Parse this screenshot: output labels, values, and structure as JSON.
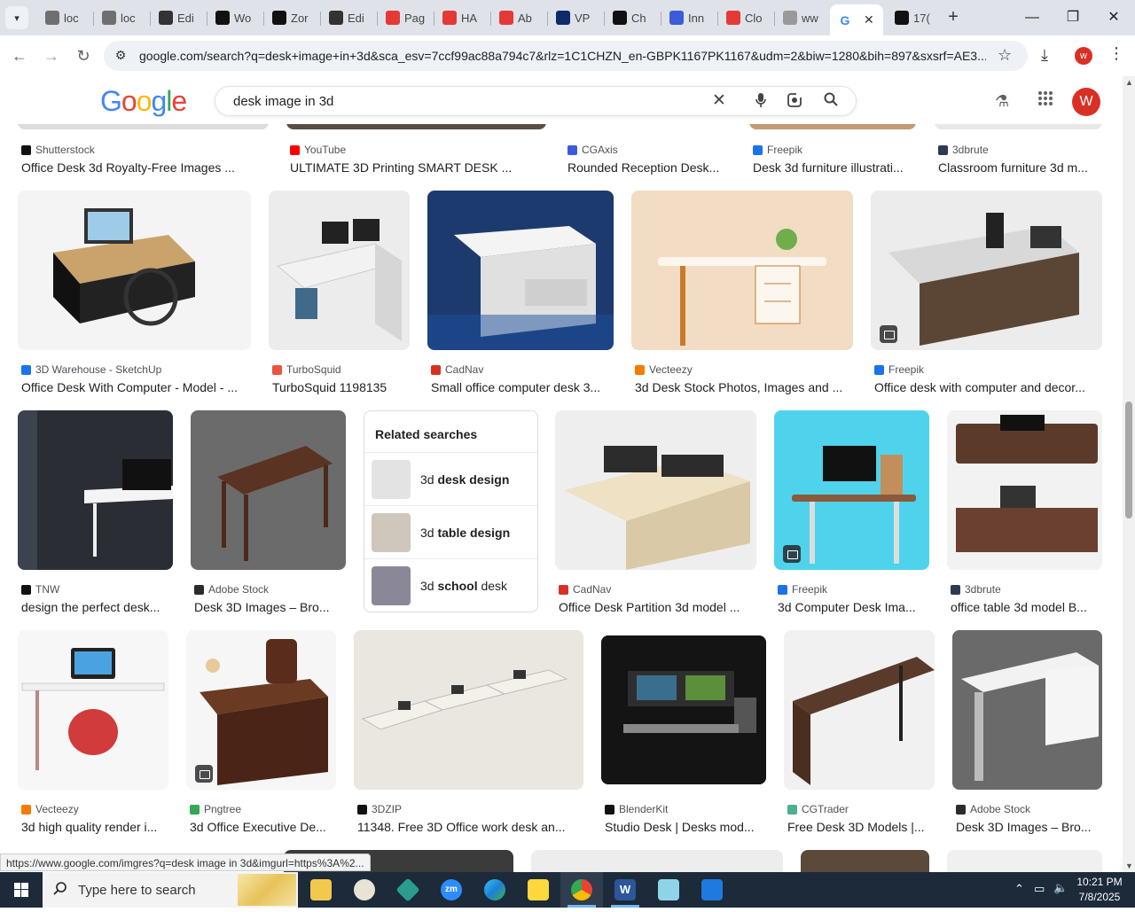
{
  "browser": {
    "tabs": [
      {
        "title": "loc",
        "favicon": "#6f6f6f",
        "icon": "doc-icon"
      },
      {
        "title": "loc",
        "favicon": "#6f6f6f",
        "icon": "doc-icon"
      },
      {
        "title": "Edi",
        "favicon": "#333333",
        "icon": "globe-icon"
      },
      {
        "title": "Wo",
        "favicon": "#111111",
        "icon": "chatgpt-icon"
      },
      {
        "title": "Zor",
        "favicon": "#111111",
        "icon": "z-icon"
      },
      {
        "title": "Edi",
        "favicon": "#333333",
        "icon": "globe-icon"
      },
      {
        "title": "Pag",
        "favicon": "#e53935",
        "icon": "diamond-icon"
      },
      {
        "title": "HA",
        "favicon": "#e53935",
        "icon": "diamond-icon"
      },
      {
        "title": "Ab",
        "favicon": "#e53935",
        "icon": "diamond-icon"
      },
      {
        "title": "VP",
        "favicon": "#0d2a6b",
        "icon": "v-icon"
      },
      {
        "title": "Ch",
        "favicon": "#111111",
        "icon": "chatgpt-icon"
      },
      {
        "title": "Inn",
        "favicon": "#3b5bdb",
        "icon": "inn-icon"
      },
      {
        "title": "Clo",
        "favicon": "#e53935",
        "icon": "slash-icon"
      },
      {
        "title": "ww",
        "favicon": "#999999",
        "icon": "circle-icon"
      },
      {
        "title": "",
        "favicon": "#4285f4",
        "icon": "google-icon",
        "active": true
      },
      {
        "title": "17(",
        "favicon": "#111111",
        "icon": "dollar-icon"
      }
    ],
    "url": "google.com/search?q=desk+image+in+3d&sca_esv=7ccf99ac88a794c7&rlz=1C1CHZN_en-GBPK1167PK1167&udm=2&biw=1280&bih=897&sxsrf=AE3...",
    "profile_initial": "w"
  },
  "google": {
    "logo": [
      "G",
      "o",
      "o",
      "g",
      "l",
      "e"
    ],
    "logo_colors": [
      "#4285f4",
      "#ea4335",
      "#fbbc05",
      "#4285f4",
      "#34a853",
      "#ea4335"
    ],
    "query": "desk image in 3d",
    "avatar_initial": "W"
  },
  "results": [
    {
      "source": "Shutterstock",
      "title": "Office Desk 3d Royalty-Free Images ...",
      "fav": "#111111"
    },
    {
      "source": "YouTube",
      "title": "ULTIMATE 3D Printing SMART DESK ...",
      "fav": "#ff0000"
    },
    {
      "source": "CGAxis",
      "title": "Rounded Reception Desk...",
      "fav": "#3b5bdb"
    },
    {
      "source": "Freepik",
      "title": "Desk 3d furniture illustrati...",
      "fav": "#1a73e8"
    },
    {
      "source": "3dbrute",
      "title": "Classroom furniture 3d m...",
      "fav": "#2b3a55"
    },
    {
      "source": "3D Warehouse - SketchUp",
      "title": "Office Desk With Computer - Model - ...",
      "fav": "#1a73e8"
    },
    {
      "source": "TurboSquid",
      "title": "TurboSquid 1198135",
      "fav": "#e8553d"
    },
    {
      "source": "CadNav",
      "title": "Small office computer desk 3...",
      "fav": "#d93025"
    },
    {
      "source": "Vecteezy",
      "title": "3d Desk Stock Photos, Images and ...",
      "fav": "#f57c00"
    },
    {
      "source": "Freepik",
      "title": "Office desk with computer and decor...",
      "fav": "#1a73e8"
    },
    {
      "source": "TNW",
      "title": "design the perfect desk...",
      "fav": "#111111"
    },
    {
      "source": "Adobe Stock",
      "title": "Desk 3D Images – Bro...",
      "fav": "#2b2b2b"
    },
    {
      "source": "CadNav",
      "title": "Office Desk Partition 3d model ...",
      "fav": "#d93025"
    },
    {
      "source": "Freepik",
      "title": "3d Computer Desk Ima...",
      "fav": "#1a73e8"
    },
    {
      "source": "3dbrute",
      "title": "office table 3d model B...",
      "fav": "#2b3a55"
    },
    {
      "source": "Vecteezy",
      "title": "3d high quality render i...",
      "fav": "#f57c00"
    },
    {
      "source": "Pngtree",
      "title": "3d Office Executive De...",
      "fav": "#34a853"
    },
    {
      "source": "3DZIP",
      "title": "11348. Free 3D Office work desk an...",
      "fav": "#111111"
    },
    {
      "source": "BlenderKit",
      "title": "Studio Desk | Desks mod...",
      "fav": "#111111"
    },
    {
      "source": "CGTrader",
      "title": "Free Desk 3D Models |...",
      "fav": "#4caf8f"
    },
    {
      "source": "Adobe Stock",
      "title": "Desk 3D Images – Bro...",
      "fav": "#2b2b2b"
    }
  ],
  "related": {
    "title": "Related searches",
    "items": [
      {
        "prefix": "3d ",
        "bold": "desk design"
      },
      {
        "prefix": "3d ",
        "bold": "table design"
      },
      {
        "prefix": "3d ",
        "bold": "school",
        "suffix": " desk"
      }
    ]
  },
  "status_url": "https://www.google.com/imgres?q=desk image in 3d&imgurl=https%3A%2...",
  "taskbar": {
    "search_placeholder": "Type here to search",
    "time": "10:21 PM",
    "date": "7/8/2025"
  }
}
